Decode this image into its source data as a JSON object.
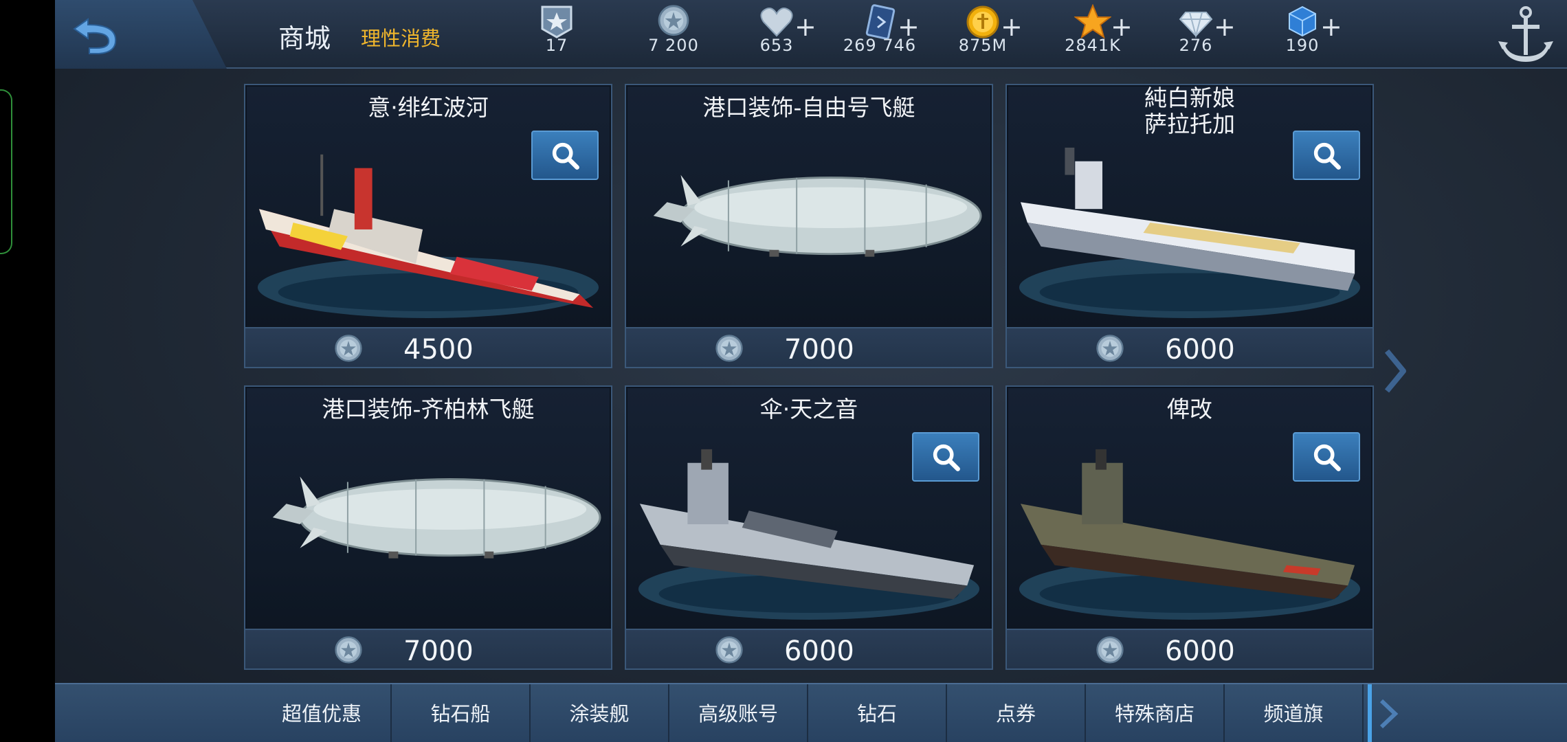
{
  "header": {
    "title": "商城",
    "subtitle": "理性消费"
  },
  "resources": [
    {
      "name": "rank",
      "value": "17",
      "has_plus": false
    },
    {
      "name": "coupon",
      "value": "7 200",
      "has_plus": false
    },
    {
      "name": "heart",
      "value": "653",
      "has_plus": true
    },
    {
      "name": "card",
      "value": "269 746",
      "has_plus": true
    },
    {
      "name": "gold",
      "value": "875M",
      "has_plus": true
    },
    {
      "name": "star",
      "value": "2841K",
      "has_plus": true
    },
    {
      "name": "diamond",
      "value": "276",
      "has_plus": true
    },
    {
      "name": "cube",
      "value": "190",
      "has_plus": true
    }
  ],
  "items": [
    {
      "title": "意·绯红波河",
      "price": "4500",
      "has_zoom": true,
      "art": "battleship-red"
    },
    {
      "title": "港口装饰-自由号飞艇",
      "price": "7000",
      "has_zoom": false,
      "art": "airship"
    },
    {
      "title": "純白新娘\n萨拉托加",
      "price": "6000",
      "has_zoom": true,
      "art": "carrier-white"
    },
    {
      "title": "港口装饰-齐柏林飞艇",
      "price": "7000",
      "has_zoom": false,
      "art": "airship"
    },
    {
      "title": "伞·天之音",
      "price": "6000",
      "has_zoom": true,
      "art": "battleship-grey"
    },
    {
      "title": "俾改",
      "price": "6000",
      "has_zoom": true,
      "art": "battleship-dark"
    }
  ],
  "tabs": [
    "超值优惠",
    "钻石船",
    "涂装舰",
    "高级账号",
    "钻石",
    "点券",
    "特殊商店",
    "频道旗"
  ],
  "colors": {
    "accent_gold": "#f0b62c",
    "button_blue": "#2f6ea6",
    "border": "#3b5879"
  }
}
